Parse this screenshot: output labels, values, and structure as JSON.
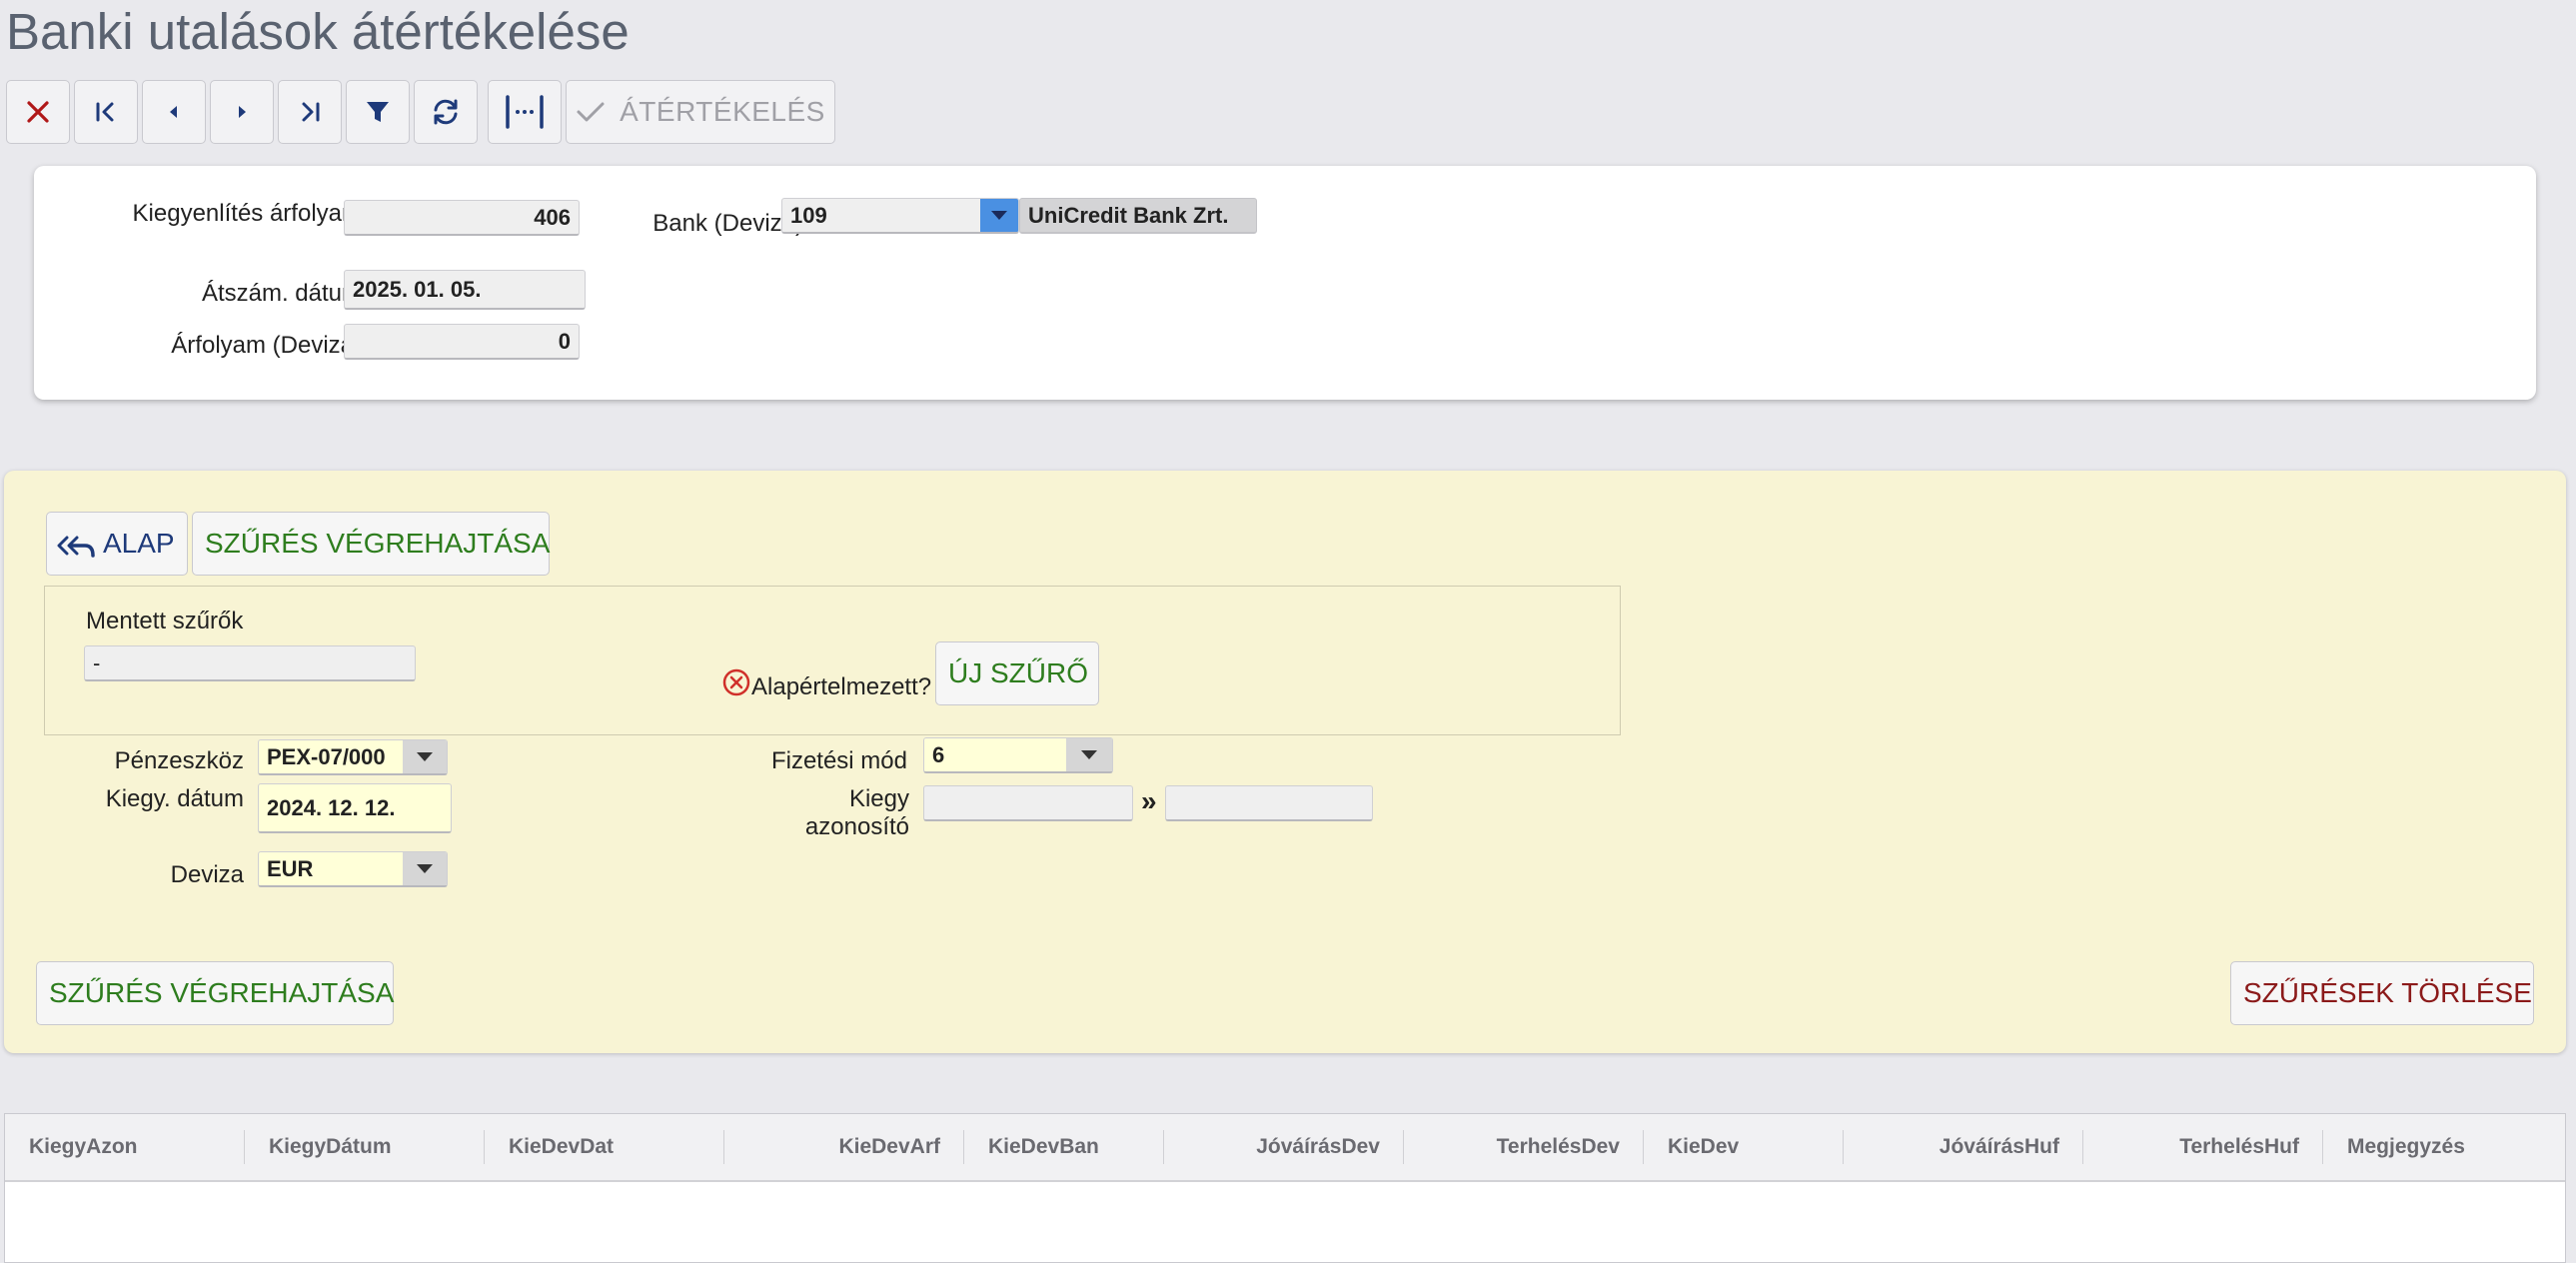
{
  "page": {
    "title": "Banki utalások átértékelése"
  },
  "toolbar": {
    "close_icon": "close-icon",
    "first_icon": "first-record-icon",
    "prev_icon": "previous-icon",
    "next_icon": "next-icon",
    "last_icon": "last-record-icon",
    "filter_icon": "filter-icon",
    "refresh_icon": "refresh-icon",
    "columns_icon": "column-width-icon",
    "revalue_label": "ÁTÉRTÉKELÉS"
  },
  "form": {
    "kiegyenlites_label": "Kiegyenlítés árfolyam",
    "kiegyenlites_value": "406",
    "atszam_label": "Átszám. dátum",
    "atszam_value": "2025. 01. 05.",
    "arfolyam_label": "Árfolyam (Deviza)",
    "arfolyam_value": "0",
    "bank_label": "Bank (Deviza)",
    "bank_code": "109",
    "bank_name": "UniCredit Bank Zrt."
  },
  "filter": {
    "alap_label": "ALAP",
    "run_label": "SZŰRÉS VÉGREHAJTÁSA",
    "saved_label": "Mentett szűrők",
    "saved_value": "-",
    "default_label": "Alapértelmezett?",
    "new_filter_label": "ÚJ SZŰRŐ",
    "penzeszkoz_label": "Pénzeszköz",
    "penzeszkoz_value": "PEX-07/000",
    "kiegy_datum_label": "Kiegy. dátum",
    "kiegy_datum_value": "2024. 12. 12.",
    "deviza_label": "Deviza",
    "deviza_value": "EUR",
    "fizetesi_label": "Fizetési mód",
    "fizetesi_value": "6",
    "kiegy_azon_label": "Kiegy azonosító",
    "kiegy_azon_from": "",
    "range_sep": "»",
    "kiegy_azon_to": "",
    "run_bottom_label": "SZŰRÉS VÉGREHAJTÁSA",
    "clear_label": "SZŰRÉSEK TÖRLÉSE"
  },
  "grid": {
    "columns": [
      "KiegyAzon",
      "KiegyDátum",
      "KieDevDat",
      "KieDevArf",
      "KieDevBan",
      "JóváírásDev",
      "TerhelésDev",
      "KieDev",
      "JóváírásHuf",
      "TerhelésHuf",
      "Megjegyzés"
    ]
  }
}
